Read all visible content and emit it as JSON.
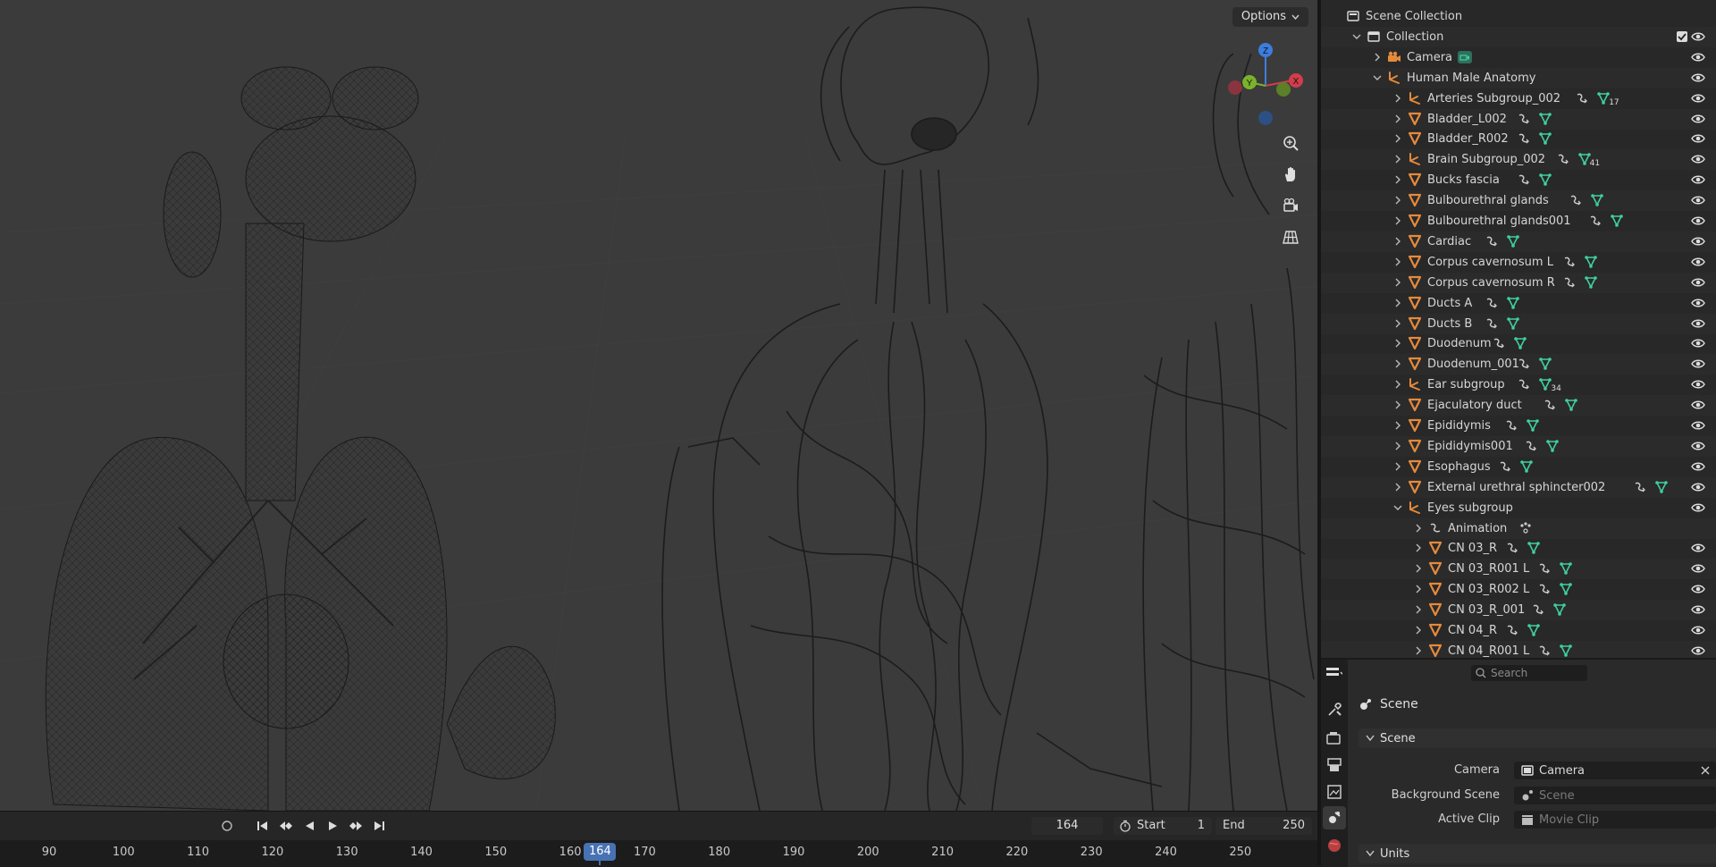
{
  "viewport": {
    "options_label": "Options",
    "gizmo_axes": {
      "z": "Z",
      "y": "Y",
      "x": "X"
    }
  },
  "timeline": {
    "current_frame": "164",
    "start_label": "Start",
    "start_value": "1",
    "end_label": "End",
    "end_value": "250",
    "ruler_ticks": [
      "90",
      "100",
      "110",
      "120",
      "130",
      "140",
      "150",
      "160",
      "170",
      "180",
      "190",
      "200",
      "210",
      "220",
      "230",
      "240",
      "250"
    ],
    "ruler_current": "164"
  },
  "outliner": {
    "rows": [
      {
        "label": "Scene Collection",
        "indent": 0,
        "icon": "scene-collection-icon",
        "arrow": "none"
      },
      {
        "label": "Collection",
        "indent": 1,
        "icon": "collection-icon",
        "arrow": "down",
        "checkbox": true
      },
      {
        "label": "Camera",
        "indent": 2,
        "icon": "camera-object-icon",
        "arrow": "right",
        "extra": [
          "camera-data-icon"
        ]
      },
      {
        "label": "Human Male Anatomy",
        "indent": 2,
        "icon": "empty-icon",
        "arrow": "down"
      },
      {
        "label": "Arteries Subgroup_002",
        "indent": 3,
        "icon": "empty-icon",
        "arrow": "right",
        "extra": [
          "modifier-icon",
          "mesh-data-icon"
        ],
        "badge": "17"
      },
      {
        "label": "Bladder_L002",
        "indent": 3,
        "icon": "mesh-icon",
        "arrow": "right",
        "extra": [
          "modifier-icon",
          "mesh-data-icon"
        ]
      },
      {
        "label": "Bladder_R002",
        "indent": 3,
        "icon": "mesh-icon",
        "arrow": "right",
        "extra": [
          "modifier-icon",
          "mesh-data-icon"
        ]
      },
      {
        "label": "Brain Subgroup_002",
        "indent": 3,
        "icon": "empty-icon",
        "arrow": "right",
        "extra": [
          "modifier-icon",
          "mesh-data-icon"
        ],
        "badge": "41"
      },
      {
        "label": "Bucks fascia",
        "indent": 3,
        "icon": "mesh-icon",
        "arrow": "right",
        "extra": [
          "modifier-icon",
          "mesh-data-icon"
        ]
      },
      {
        "label": "Bulbourethral glands",
        "indent": 3,
        "icon": "mesh-icon",
        "arrow": "right",
        "extra": [
          "modifier-icon",
          "mesh-data-icon"
        ]
      },
      {
        "label": "Bulbourethral glands001",
        "indent": 3,
        "icon": "mesh-icon",
        "arrow": "right",
        "extra": [
          "modifier-icon",
          "mesh-data-icon"
        ]
      },
      {
        "label": "Cardiac",
        "indent": 3,
        "icon": "mesh-icon",
        "arrow": "right",
        "extra": [
          "modifier-icon",
          "mesh-data-icon"
        ]
      },
      {
        "label": "Corpus cavernosum L",
        "indent": 3,
        "icon": "mesh-icon",
        "arrow": "right",
        "extra": [
          "modifier-icon",
          "mesh-data-icon"
        ]
      },
      {
        "label": "Corpus cavernosum R",
        "indent": 3,
        "icon": "mesh-icon",
        "arrow": "right",
        "extra": [
          "modifier-icon",
          "mesh-data-icon"
        ]
      },
      {
        "label": "Ducts A",
        "indent": 3,
        "icon": "mesh-icon",
        "arrow": "right",
        "extra": [
          "modifier-icon",
          "mesh-data-icon"
        ]
      },
      {
        "label": "Ducts B",
        "indent": 3,
        "icon": "mesh-icon",
        "arrow": "right",
        "extra": [
          "modifier-icon",
          "mesh-data-icon"
        ]
      },
      {
        "label": "Duodenum",
        "indent": 3,
        "icon": "mesh-icon",
        "arrow": "right",
        "extra": [
          "modifier-icon",
          "mesh-data-icon"
        ]
      },
      {
        "label": "Duodenum_001",
        "indent": 3,
        "icon": "mesh-icon",
        "arrow": "right",
        "extra": [
          "modifier-icon",
          "mesh-data-icon"
        ]
      },
      {
        "label": "Ear subgroup",
        "indent": 3,
        "icon": "empty-icon",
        "arrow": "right",
        "extra": [
          "modifier-icon",
          "mesh-data-icon"
        ],
        "badge": "34"
      },
      {
        "label": "Ejaculatory duct",
        "indent": 3,
        "icon": "mesh-icon",
        "arrow": "right",
        "extra": [
          "modifier-icon",
          "mesh-data-icon"
        ]
      },
      {
        "label": "Epididymis",
        "indent": 3,
        "icon": "mesh-icon",
        "arrow": "right",
        "extra": [
          "modifier-icon",
          "mesh-data-icon"
        ]
      },
      {
        "label": "Epididymis001",
        "indent": 3,
        "icon": "mesh-icon",
        "arrow": "right",
        "extra": [
          "modifier-icon",
          "mesh-data-icon"
        ]
      },
      {
        "label": "Esophagus",
        "indent": 3,
        "icon": "mesh-icon",
        "arrow": "right",
        "extra": [
          "modifier-icon",
          "mesh-data-icon"
        ]
      },
      {
        "label": "External urethral sphincter002",
        "indent": 3,
        "icon": "mesh-icon",
        "arrow": "right",
        "extra": [
          "modifier-icon",
          "mesh-data-icon"
        ]
      },
      {
        "label": "Eyes subgroup",
        "indent": 3,
        "icon": "empty-icon",
        "arrow": "down"
      },
      {
        "label": "Animation",
        "indent": 4,
        "icon": "animation-icon",
        "arrow": "right",
        "extra": [
          "action-icon"
        ],
        "no_eye": true
      },
      {
        "label": "CN 03_R",
        "indent": 4,
        "icon": "mesh-icon",
        "arrow": "right",
        "extra": [
          "modifier-icon",
          "mesh-data-icon"
        ]
      },
      {
        "label": "CN 03_R001 L",
        "indent": 4,
        "icon": "mesh-icon",
        "arrow": "right",
        "extra": [
          "modifier-icon",
          "mesh-data-icon"
        ]
      },
      {
        "label": "CN 03_R002 L",
        "indent": 4,
        "icon": "mesh-icon",
        "arrow": "right",
        "extra": [
          "modifier-icon",
          "mesh-data-icon"
        ]
      },
      {
        "label": "CN 03_R_001",
        "indent": 4,
        "icon": "mesh-icon",
        "arrow": "right",
        "extra": [
          "modifier-icon",
          "mesh-data-icon"
        ]
      },
      {
        "label": "CN 04_R",
        "indent": 4,
        "icon": "mesh-icon",
        "arrow": "right",
        "extra": [
          "modifier-icon",
          "mesh-data-icon"
        ]
      },
      {
        "label": "CN 04_R001 L",
        "indent": 4,
        "icon": "mesh-icon",
        "arrow": "right",
        "extra": [
          "modifier-icon",
          "mesh-data-icon"
        ]
      }
    ]
  },
  "properties": {
    "search_placeholder": "Search",
    "context_title": "Scene",
    "scene_panel_title": "Scene",
    "camera_label": "Camera",
    "camera_value": "Camera",
    "background_scene_label": "Background Scene",
    "background_scene_placeholder": "Scene",
    "active_clip_label": "Active Clip",
    "active_clip_placeholder": "Movie Clip",
    "units_panel_title": "Units"
  },
  "colors": {
    "accent_blue": "#4772b3",
    "mesh_orange": "#e58a3c",
    "data_green": "#3fd0a0",
    "viewport_bg": "#3b3b3b"
  }
}
